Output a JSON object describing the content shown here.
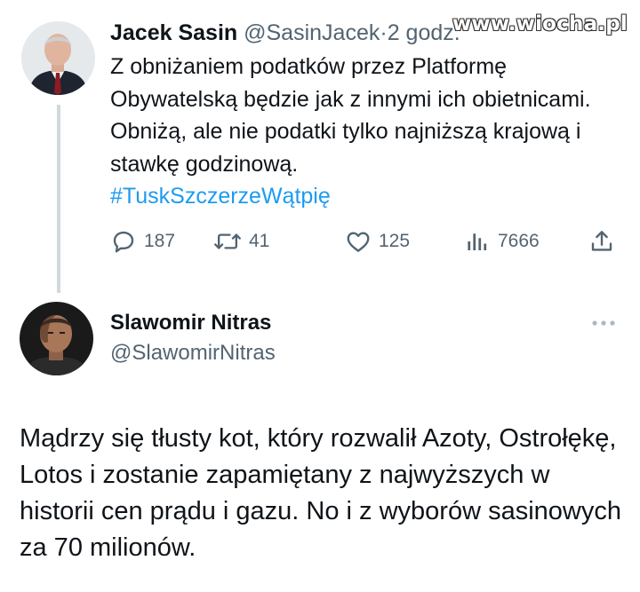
{
  "watermark": "www.wiocha.pl",
  "tweet1": {
    "author_name": "Jacek Sasin",
    "handle": "@SasinJacek",
    "separator": "·",
    "time": "2 godz.",
    "text": "Z obniżaniem podatków przez Platformę Obywatelską będzie jak z innymi ich obietnicami. Obniżą, ale nie podatki tylko najniższą krajową i stawkę godzinową.",
    "hashtag": "#TuskSzczerzeWątpię",
    "replies": "187",
    "retweets": "41",
    "likes": "125",
    "views": "7666"
  },
  "tweet2": {
    "author_name": "Slawomir Nitras",
    "handle": "@SlawomirNitras",
    "text": "Mądrzy się tłusty kot, który rozwalił Azoty, Ostrołękę, Lotos i zostanie zapamiętany z najwyższych w historii cen prądu i gazu. No i z wyborów sasinowych za 70 milionów."
  },
  "colors": {
    "text": "#0f1419",
    "secondary": "#536471",
    "link": "#1d9bf0",
    "thread_line": "#cfd9de"
  },
  "icons": [
    "reply-icon",
    "retweet-icon",
    "like-icon",
    "views-icon",
    "share-icon",
    "more-icon"
  ]
}
